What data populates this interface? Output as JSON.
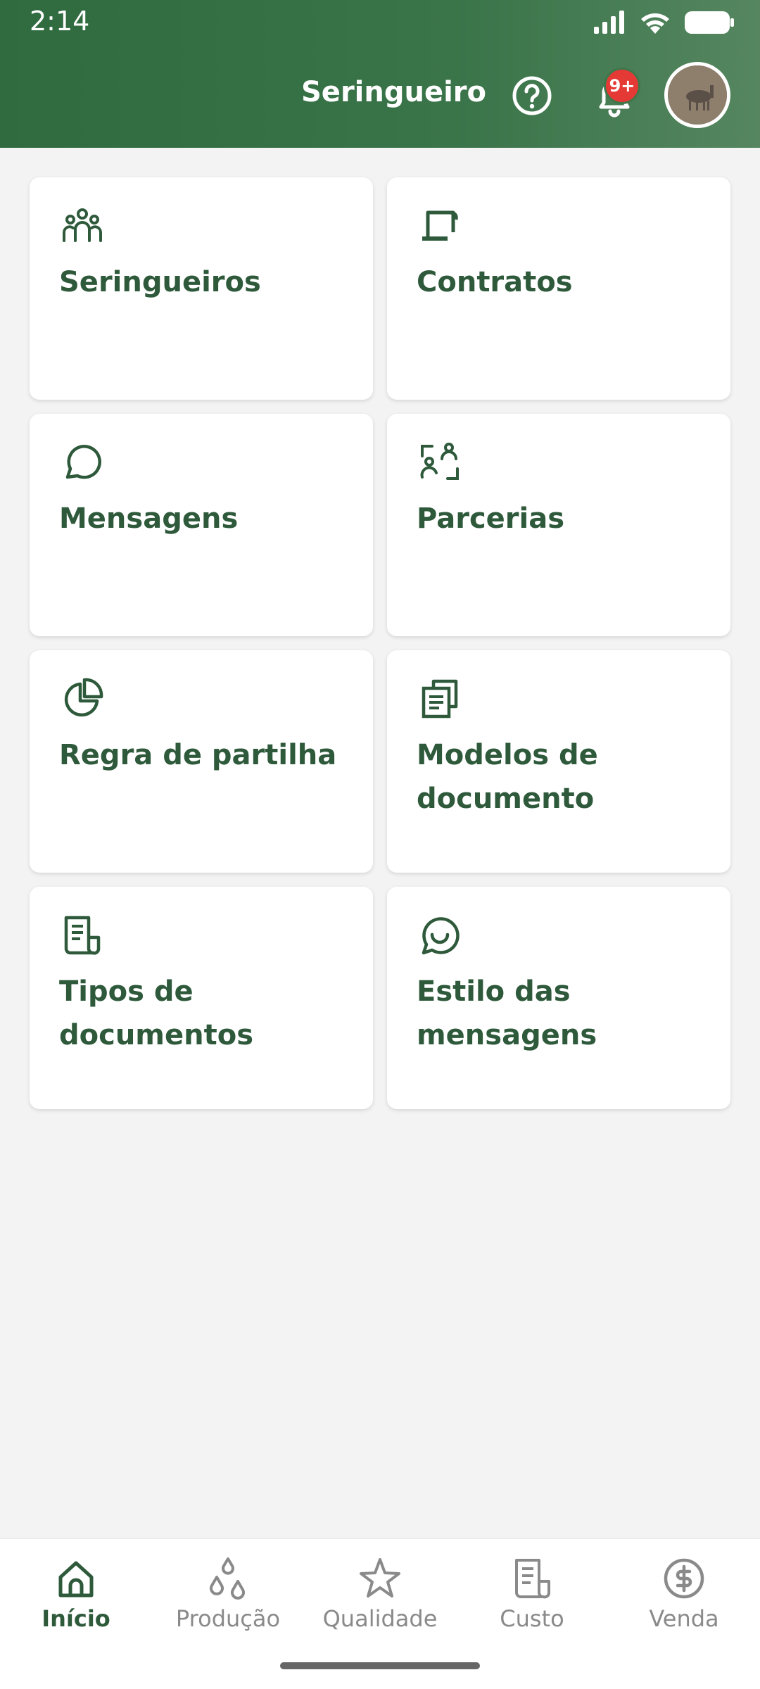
{
  "status_bar": {
    "time": "2:14"
  },
  "header": {
    "title": "Seringueiro",
    "notification_badge": "9+",
    "icons": [
      "help-icon",
      "bell-icon",
      "avatar"
    ]
  },
  "cards": [
    {
      "label": "Seringueiros",
      "icon": "people-group-icon"
    },
    {
      "label": "Contratos",
      "icon": "scroll-icon"
    },
    {
      "label": "Mensagens",
      "icon": "chat-bubble-icon"
    },
    {
      "label": "Parcerias",
      "icon": "partners-icon"
    },
    {
      "label": "Regra de partilha",
      "icon": "pie-chart-icon"
    },
    {
      "label": "Modelos de documento",
      "icon": "documents-copy-icon"
    },
    {
      "label": "Tipos de documentos",
      "icon": "document-list-icon"
    },
    {
      "label": "Estilo das mensagens",
      "icon": "whatsapp-icon"
    }
  ],
  "bottom_nav": [
    {
      "label": "Início",
      "icon": "home-icon",
      "active": true
    },
    {
      "label": "Produção",
      "icon": "drops-icon",
      "active": false
    },
    {
      "label": "Qualidade",
      "icon": "star-icon",
      "active": false
    },
    {
      "label": "Custo",
      "icon": "receipt-icon",
      "active": false
    },
    {
      "label": "Venda",
      "icon": "dollar-coin-icon",
      "active": false
    }
  ],
  "colors": {
    "header_green": "#3a7449",
    "text_green": "#2e5a3b",
    "badge_red": "#e53935",
    "background": "#f3f3f3"
  }
}
